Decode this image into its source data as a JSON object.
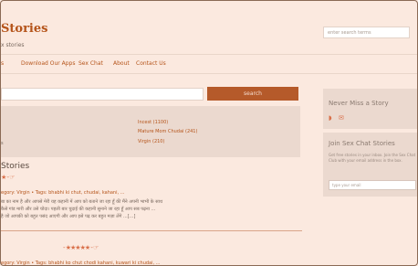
{
  "site": {
    "logo": "Stories",
    "tagline": "x stories"
  },
  "header": {
    "search_placeholder": "enter search terms"
  },
  "nav": {
    "items": [
      "s",
      "Download Our Apps",
      "Sex Chat",
      "About",
      "Contact Us"
    ]
  },
  "main_search": {
    "button_label": "search"
  },
  "filters": {
    "left": "s",
    "right": [
      "Incest (1100)",
      "Mature Mom Chudai (241)",
      "Virgin (210)"
    ]
  },
  "section": {
    "title": "Stories"
  },
  "story1": {
    "stars": "★ - ☞",
    "meta": "egory: Virgin  •  Tags: bhabhi ki chut, chudai, kahani, ...",
    "excerpt1": "बा का नाम है और आपसे मेरी यह कहानी में आप को बताने जा रहा हूँ की मैंने अपनी भाभी के साथ",
    "excerpt2": "कैसे गांड मारी और उसे चोदा। पहली बार चुदाई की कहानी सुनाने जा रहा हूँ आप सब पढ़ना ...",
    "excerpt3": "है जो आपकी को बहुत पसंद आएगी और आप इसे पढ़ कर बहुत मज़ा लेंगे ...[...]"
  },
  "story2": {
    "stars": "- ★★★★★ - ☞",
    "meta": "egory: Virgin  •  Tags: bhabhi ko chut chodi kahani, kuwari ki chudai, ..."
  },
  "sidebar": {
    "box1_title": "Never Miss a Story",
    "box1_icons": "rss-icon mail-icon",
    "box2_title": "Join Sex Chat Stories",
    "box2_text": "Get free stories in your inbox. Join the Sex Chat Club with your email address in the box.",
    "email_placeholder": "type your email"
  }
}
